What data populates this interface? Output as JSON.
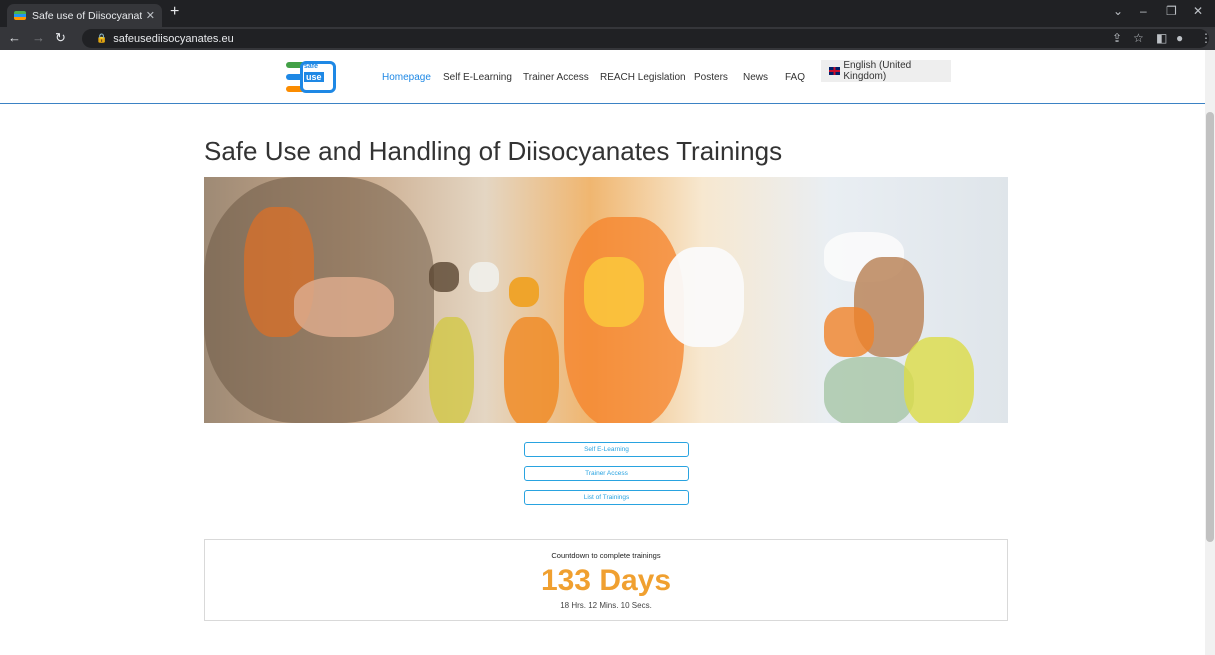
{
  "browser": {
    "tab_title": "Safe use of Diisocyanates - Hom",
    "url": "safeusediisocyanates.eu"
  },
  "header": {
    "logo_text_top": "safe",
    "logo_text_bottom": "use",
    "nav": [
      "Homepage",
      "Self E-Learning",
      "Trainer Access",
      "REACH Legislation",
      "Posters",
      "News",
      "FAQ"
    ],
    "language": "English (United Kingdom)"
  },
  "main": {
    "title": "Safe Use and Handling of Diisocyanates Trainings",
    "buttons": [
      "Self E-Learning",
      "Trainer Access",
      "List of Trainings"
    ],
    "countdown": {
      "label": "Countdown to complete trainings",
      "days": "133 Days",
      "rest": "18 Hrs. 12 Mins. 10 Secs."
    }
  },
  "colors": {
    "accent": "#1e88e5",
    "countdown": "#f0a030",
    "button": "#29a3e0"
  }
}
